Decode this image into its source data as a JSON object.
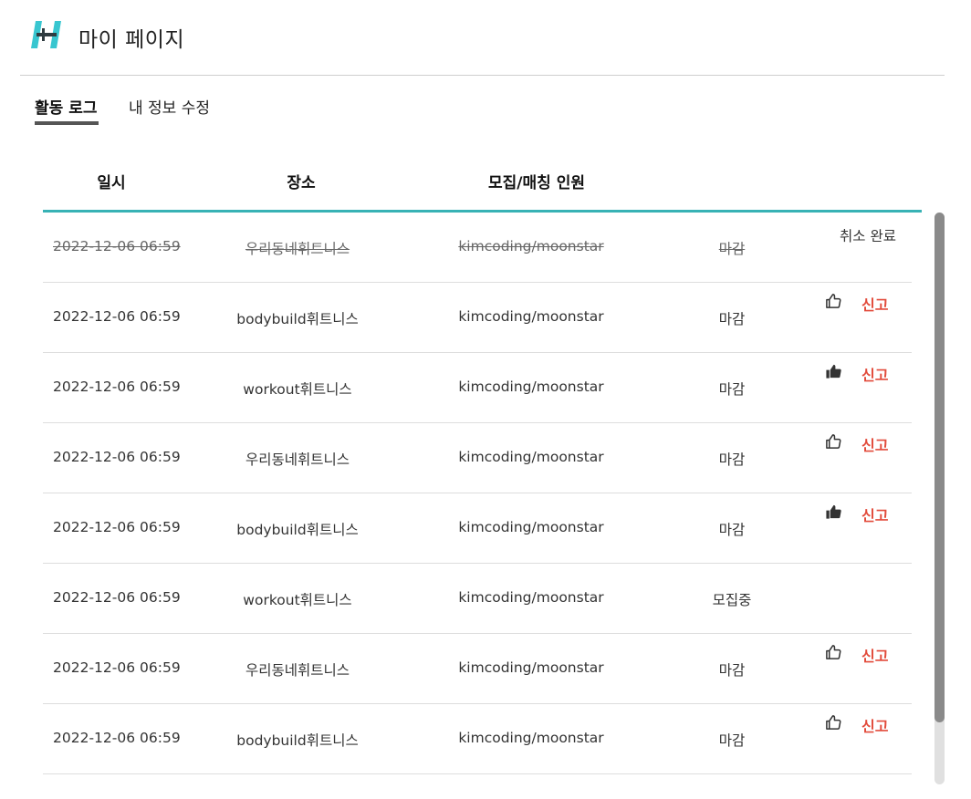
{
  "header": {
    "title": "마이 페이지",
    "logo_icon": "dumbbell-h-logo",
    "brand_color": "#38c6d0"
  },
  "tabs": [
    {
      "label": "활동 로그",
      "active": true
    },
    {
      "label": "내 정보 수정",
      "active": false
    }
  ],
  "table": {
    "columns": [
      "일시",
      "장소",
      "모집/매칭 인원"
    ],
    "accent_color": "#38b2b5",
    "rows": [
      {
        "date": "2022-12-06 06:59",
        "place": "우리동네휘트니스",
        "members": "kimcoding/moonstar",
        "status": "마감",
        "cancelled": true,
        "action_text": "취소 완료"
      },
      {
        "date": "2022-12-06 06:59",
        "place": "bodybuild휘트니스",
        "members": "kimcoding/moonstar",
        "status": "마감",
        "like": "outline",
        "report": "신고"
      },
      {
        "date": "2022-12-06 06:59",
        "place": "workout휘트니스",
        "members": "kimcoding/moonstar",
        "status": "마감",
        "like": "filled",
        "report": "신고"
      },
      {
        "date": "2022-12-06 06:59",
        "place": "우리동네휘트니스",
        "members": "kimcoding/moonstar",
        "status": "마감",
        "like": "outline",
        "report": "신고"
      },
      {
        "date": "2022-12-06 06:59",
        "place": "bodybuild휘트니스",
        "members": "kimcoding/moonstar",
        "status": "마감",
        "like": "filled",
        "report": "신고"
      },
      {
        "date": "2022-12-06 06:59",
        "place": "workout휘트니스",
        "members": "kimcoding/moonstar",
        "status": "모집중"
      },
      {
        "date": "2022-12-06 06:59",
        "place": "우리동네휘트니스",
        "members": "kimcoding/moonstar",
        "status": "마감",
        "like": "outline",
        "report": "신고"
      },
      {
        "date": "2022-12-06 06:59",
        "place": "bodybuild휘트니스",
        "members": "kimcoding/moonstar",
        "status": "마감",
        "like": "outline",
        "report": "신고"
      }
    ]
  },
  "colors": {
    "report": "#e24b3b",
    "divider": "#dddddd"
  }
}
